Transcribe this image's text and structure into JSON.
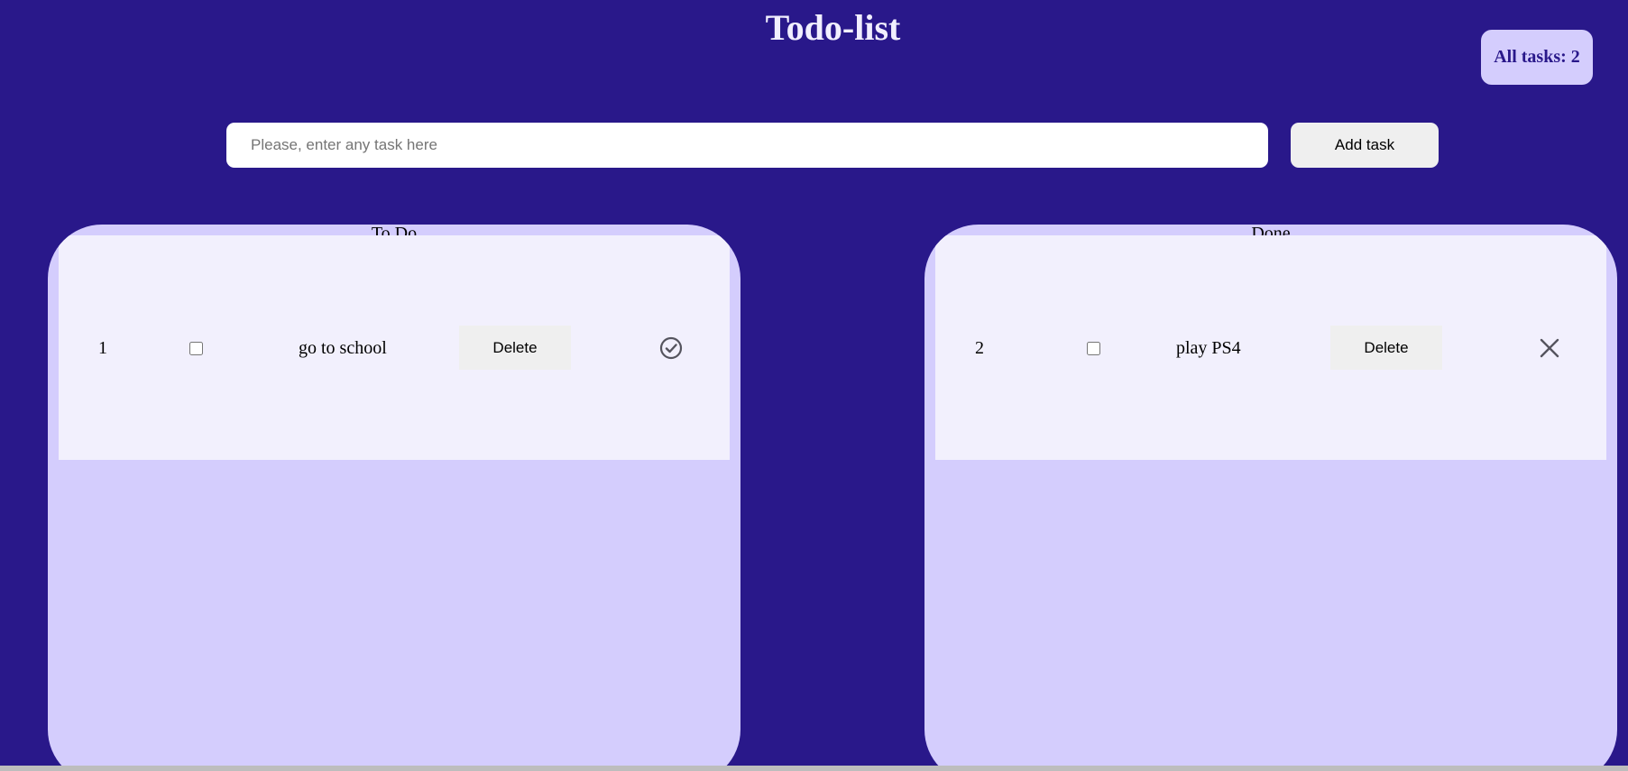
{
  "header": {
    "title": "Todo-list",
    "counter": "All tasks: 2"
  },
  "form": {
    "placeholder": "Please, enter any task here",
    "value": "",
    "add_label": "Add task"
  },
  "columns": {
    "todo": {
      "title": "To Do",
      "tasks": [
        {
          "number": "1",
          "text": "go to school",
          "checked": false,
          "delete_label": "Delete",
          "action_icon": "check-circle-icon"
        }
      ]
    },
    "done": {
      "title": "Done",
      "tasks": [
        {
          "number": "2",
          "text": "play PS4",
          "checked": false,
          "delete_label": "Delete",
          "action_icon": "close-icon"
        }
      ]
    }
  },
  "colors": {
    "background": "#29188a",
    "column": "#d4cdfd",
    "row": "#f2f0fd",
    "title": "#f1efff"
  }
}
